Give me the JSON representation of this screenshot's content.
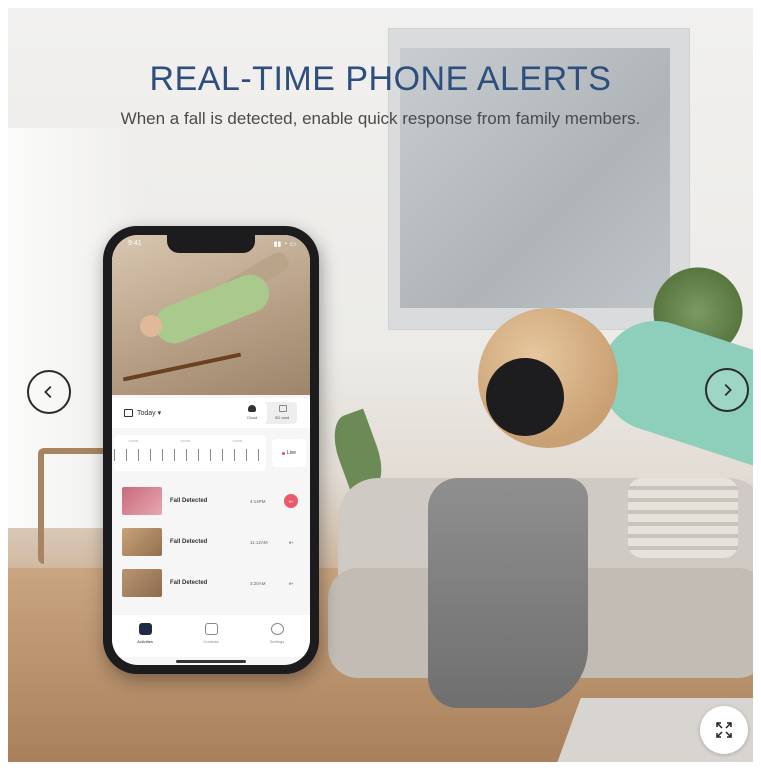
{
  "header": {
    "title": "REAL-TIME PHONE ALERTS",
    "subtitle": "When a fall is detected, enable quick response from family members."
  },
  "phone": {
    "status_time": "9:41",
    "toolbar": {
      "date_label": "Today ▾",
      "cloud_label": "Cloud",
      "sd_label": "SD card"
    },
    "timeline_labels": [
      "4:00PM",
      "4:00PM",
      "4:00PM"
    ],
    "live_label": "Live",
    "events": [
      {
        "title": "Fall Detected",
        "time": "4:14PM",
        "badge": "9+",
        "active": true
      },
      {
        "title": "Fall Detected",
        "time": "11:12AM",
        "badge": "9+",
        "active": false
      },
      {
        "title": "Fall Detected",
        "time": "3:20AM",
        "badge": "9+",
        "active": false
      }
    ],
    "tabs": [
      {
        "label": "Activities",
        "active": true
      },
      {
        "label": "Controls",
        "active": false
      },
      {
        "label": "Settings",
        "active": false
      }
    ]
  },
  "icons": {
    "prev": "chevron-left-icon",
    "next": "chevron-right-icon",
    "expand": "expand-icon"
  },
  "colors": {
    "title": "#2e4e7e",
    "alert": "#ea5a6c",
    "device_arm": "#8ecfbc"
  }
}
